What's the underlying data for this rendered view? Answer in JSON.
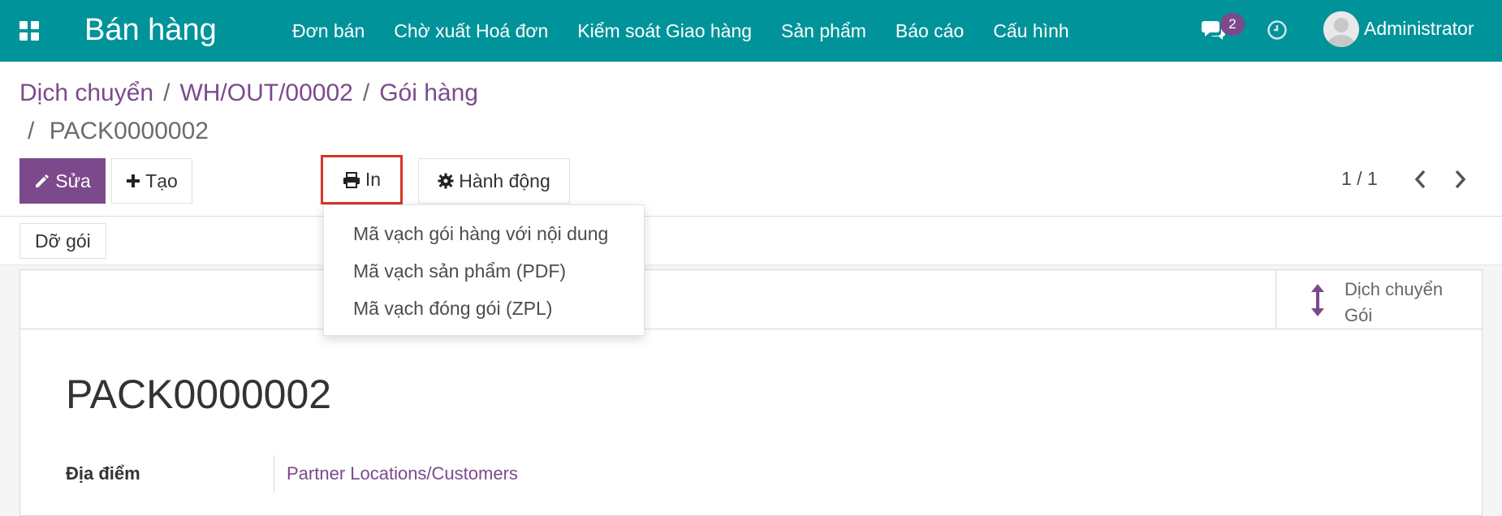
{
  "navbar": {
    "app_title": "Bán hàng",
    "menu": [
      "Đơn bán",
      "Chờ xuất Hoá đơn",
      "Kiểm soát Giao hàng",
      "Sản phẩm",
      "Báo cáo",
      "Cấu hình"
    ],
    "chat_count": "2",
    "user_name": "Administrator",
    "icons": [
      "apps-icon",
      "chat-icon",
      "clock-icon",
      "avatar"
    ],
    "bg_color": "#00939a"
  },
  "breadcrumb": {
    "items": [
      "Dịch chuyển",
      "WH/OUT/00002",
      "Gói hàng"
    ],
    "current": "PACK0000002",
    "separator": "/"
  },
  "toolbar": {
    "edit_label": "Sửa",
    "create_label": "Tạo",
    "print_label": "In",
    "action_label": "Hành động",
    "pager": "1 / 1"
  },
  "print_menu": {
    "items": [
      "Mã vạch gói hàng với nội dung",
      "Mã vạch sản phẩm (PDF)",
      "Mã vạch đóng gói (ZPL)"
    ]
  },
  "statusbar": {
    "unpack_label": "Dỡ gói"
  },
  "form": {
    "smart_button_line1": "Dịch chuyển",
    "smart_button_line2": "Gói",
    "title": "PACK0000002",
    "location_label": "Địa điểm",
    "location_value": "Partner Locations/Customers"
  },
  "colors": {
    "primary": "#7c4a8c",
    "highlight": "#d9342b"
  }
}
